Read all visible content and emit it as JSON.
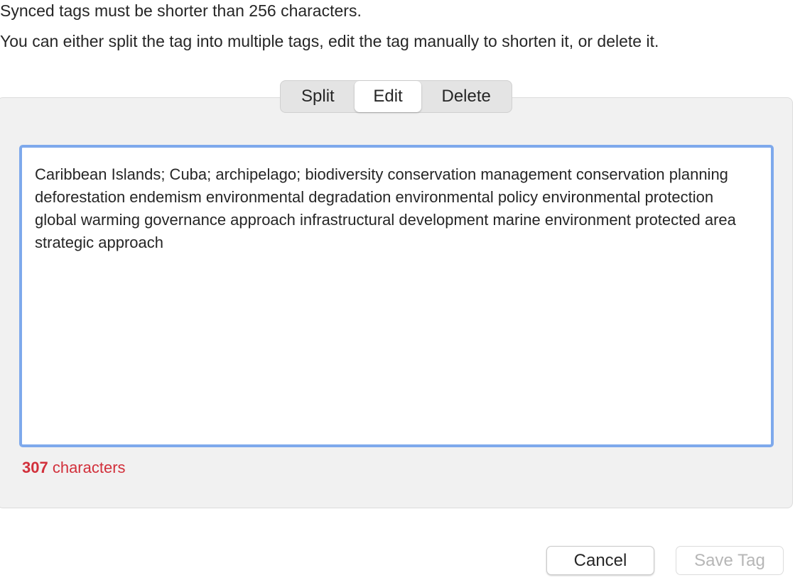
{
  "message": {
    "line1": "Synced tags must be shorter than 256 characters.",
    "line2": "You can either split the tag into multiple tags, edit the tag manually to shorten it, or delete it."
  },
  "mode_tabs": {
    "split": "Split",
    "edit": "Edit",
    "delete": "Delete",
    "selected": "Edit"
  },
  "editor": {
    "value": "Caribbean Islands; Cuba; archipelago; biodiversity conservation management conservation planning deforestation endemism environmental degradation environmental policy environmental protection global warming governance approach infrastructural development marine environment protected area strategic approach"
  },
  "counter": {
    "count": "307",
    "suffix": " characters",
    "color": "#d2303b"
  },
  "buttons": {
    "cancel": "Cancel",
    "save": "Save Tag",
    "save_enabled": false
  },
  "colors": {
    "focus_ring": "#7ea9ec",
    "error": "#d2303b"
  }
}
